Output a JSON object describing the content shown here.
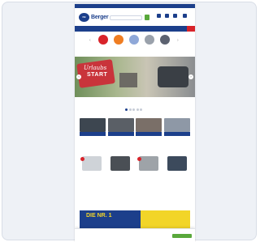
{
  "topbar": {
    "text": ""
  },
  "header": {
    "logo_word": "Berger",
    "logo_initials": "FB",
    "search_placeholder": ""
  },
  "colors": {
    "brand_blue": "#1c3f8b",
    "cart_green": "#59a83b",
    "sale_red": "#d8232a",
    "banner_yellow": "#f2d528"
  },
  "nav": {
    "items": [
      "",
      "",
      "",
      "",
      ""
    ]
  },
  "categories": [
    {
      "label": "",
      "color": "#d8232a",
      "icon": "tent-icon"
    },
    {
      "label": "",
      "color": "#ef7d22",
      "icon": "awning-icon"
    },
    {
      "label": "",
      "color": "#8fa8d8",
      "icon": "chair-icon"
    },
    {
      "label": "",
      "color": "#9aa1ab",
      "icon": "caravan-icon"
    },
    {
      "label": "",
      "color": "#5c6270",
      "icon": "van-icon"
    }
  ],
  "hero": {
    "line1": "Urlaubs",
    "line2": "START"
  },
  "sections": {
    "tiles_title": "",
    "products_title": "",
    "banner_title": ""
  },
  "tiles": [
    {
      "label": "",
      "color": "#3d4650"
    },
    {
      "label": "",
      "color": "#5a5f66"
    },
    {
      "label": "",
      "color": "#7a6f68"
    },
    {
      "label": "",
      "color": "#8e98a6"
    }
  ],
  "products": [
    {
      "name": "",
      "price": "",
      "color": "#cfd3d8"
    },
    {
      "name": "",
      "price": "",
      "color": "#4a4f55"
    },
    {
      "name": "",
      "price": "",
      "color": "#9ea3a8"
    },
    {
      "name": "",
      "price": "",
      "color": "#3c4a5c"
    }
  ],
  "banner": {
    "text": "DIE NR. 1"
  },
  "cookie": {
    "title": "",
    "body": "",
    "accept": ""
  }
}
